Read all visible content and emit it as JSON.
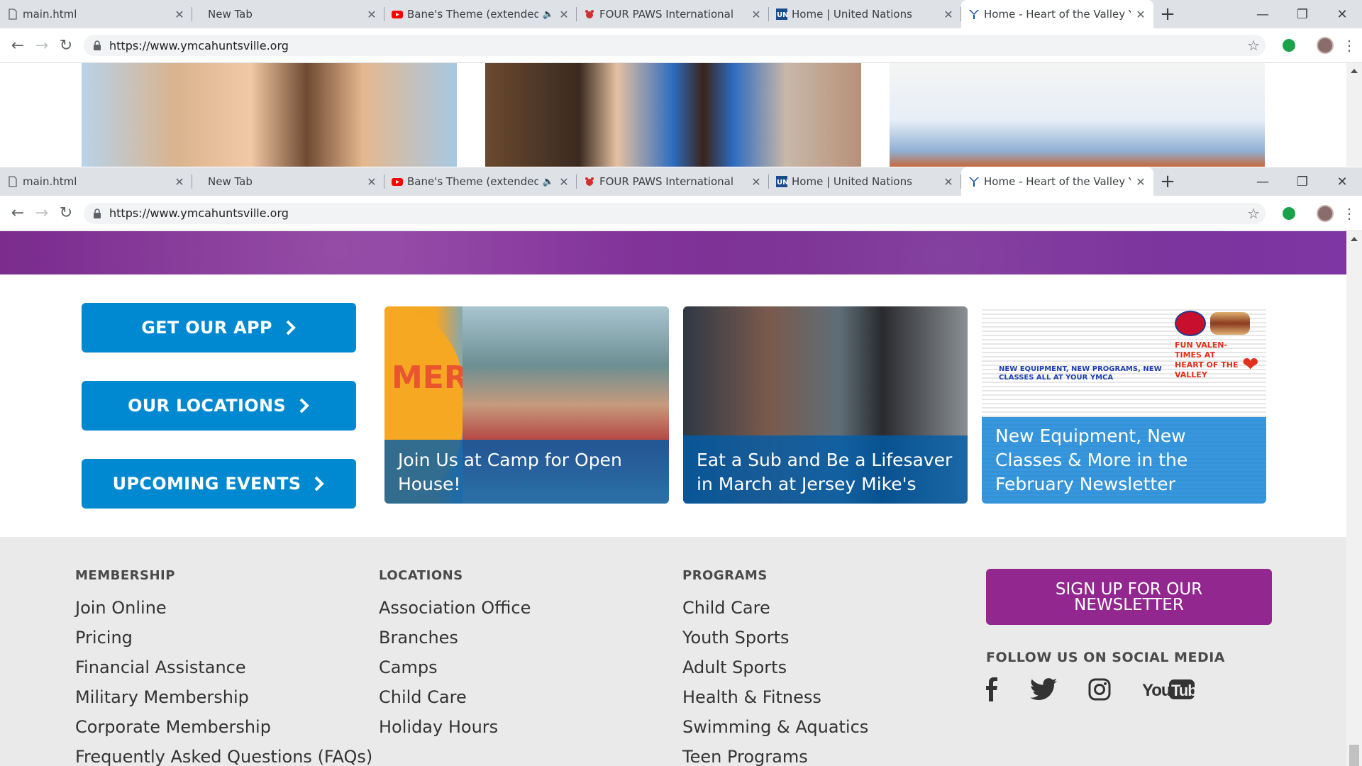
{
  "browser": {
    "tabs": [
      {
        "title": "main.html"
      },
      {
        "title": "New Tab"
      },
      {
        "title": "Bane's Theme (extended"
      },
      {
        "title": "FOUR PAWS International"
      },
      {
        "title": "Home | United Nations"
      },
      {
        "title": "Home - Heart of the Valley Y"
      }
    ],
    "url": "https://www.ymcahuntsville.org"
  },
  "cta_buttons": [
    {
      "label": "GET OUR APP"
    },
    {
      "label": "OUR LOCATIONS"
    },
    {
      "label": "UPCOMING EVENTS"
    }
  ],
  "cards": [
    {
      "caption": "Join Us at Camp for Open House!",
      "overlay_text": "MER"
    },
    {
      "caption": "Eat a Sub and Be a Lifesaver in March at Jersey Mike's"
    },
    {
      "caption": "New Equipment, New Classes & More in the February Newsletter",
      "overlay_text": "FUN VALEN-TIMES AT HEART OF THE VALLEY",
      "overlay_heading": "NEW EQUIPMENT, NEW PROGRAMS, NEW CLASSES ALL AT YOUR YMCA"
    }
  ],
  "footer": {
    "membership": {
      "heading": "MEMBERSHIP",
      "links": [
        "Join Online",
        "Pricing",
        "Financial Assistance",
        "Military Membership",
        "Corporate Membership",
        "Frequently Asked Questions (FAQs)"
      ]
    },
    "locations": {
      "heading": "LOCATIONS",
      "links": [
        "Association Office",
        "Branches",
        "Camps",
        "Child Care",
        "Holiday Hours"
      ]
    },
    "programs": {
      "heading": "PROGRAMS",
      "links": [
        "Child Care",
        "Youth Sports",
        "Adult Sports",
        "Health & Fitness",
        "Swimming & Aquatics",
        "Teen Programs"
      ]
    },
    "newsletter_button": "SIGN UP FOR OUR NEWSLETTER",
    "social_heading": "FOLLOW US ON SOCIAL MEDIA",
    "social": [
      "facebook-icon",
      "twitter-icon",
      "instagram-icon",
      "youtube-icon"
    ]
  },
  "colors": {
    "cta_blue": "#0089d0",
    "newsletter_purple": "#92278f",
    "hero_purple": "#7b2d8e",
    "footer_bg": "#eaeaea"
  }
}
